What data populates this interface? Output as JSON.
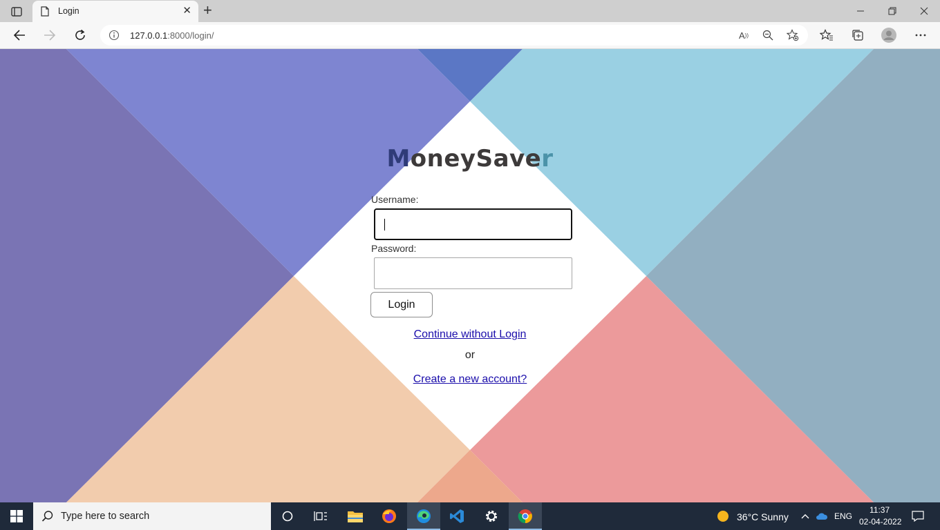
{
  "browser": {
    "tab_title": "Login",
    "url_host": "127.0.0.1",
    "url_rest": ":8000/login/"
  },
  "page": {
    "logo": {
      "first": "M",
      "middle": "oneySave",
      "last": "r"
    },
    "username_label": "Username:",
    "password_label": "Password:",
    "login_button": "Login",
    "continue_link": "Continue without Login",
    "or_text": "or",
    "create_link": "Create a new account?"
  },
  "taskbar": {
    "search_placeholder": "Type here to search",
    "weather": "36°C  Sunny",
    "language": "ENG",
    "time": "11:37",
    "date": "02-04-2022"
  },
  "icons": {
    "tab_actions": "tab-actions-icon",
    "back": "back-arrow-icon",
    "forward": "forward-arrow-icon",
    "refresh": "refresh-icon",
    "read_aloud": "read-aloud-icon",
    "zoom": "zoom-out-icon",
    "favorite_add": "add-favorite-icon",
    "favorites": "favorites-icon",
    "collections": "collections-icon",
    "profile": "profile-icon",
    "menu": "more-menu-icon"
  },
  "colors": {
    "bg_top_left": "#7e85d1",
    "bg_left": "#7a74b4",
    "bg_top_right": "#9ad0e3",
    "bg_right": "#92afc1",
    "bg_bottom_left": "#f2ccad",
    "bg_bottom_right": "#ec9a9b",
    "bg_top_center": "#5b77c5",
    "bg_bottom_center": "#eda88c",
    "link": "#1a0dab",
    "taskbar": "#1f2a3a"
  }
}
